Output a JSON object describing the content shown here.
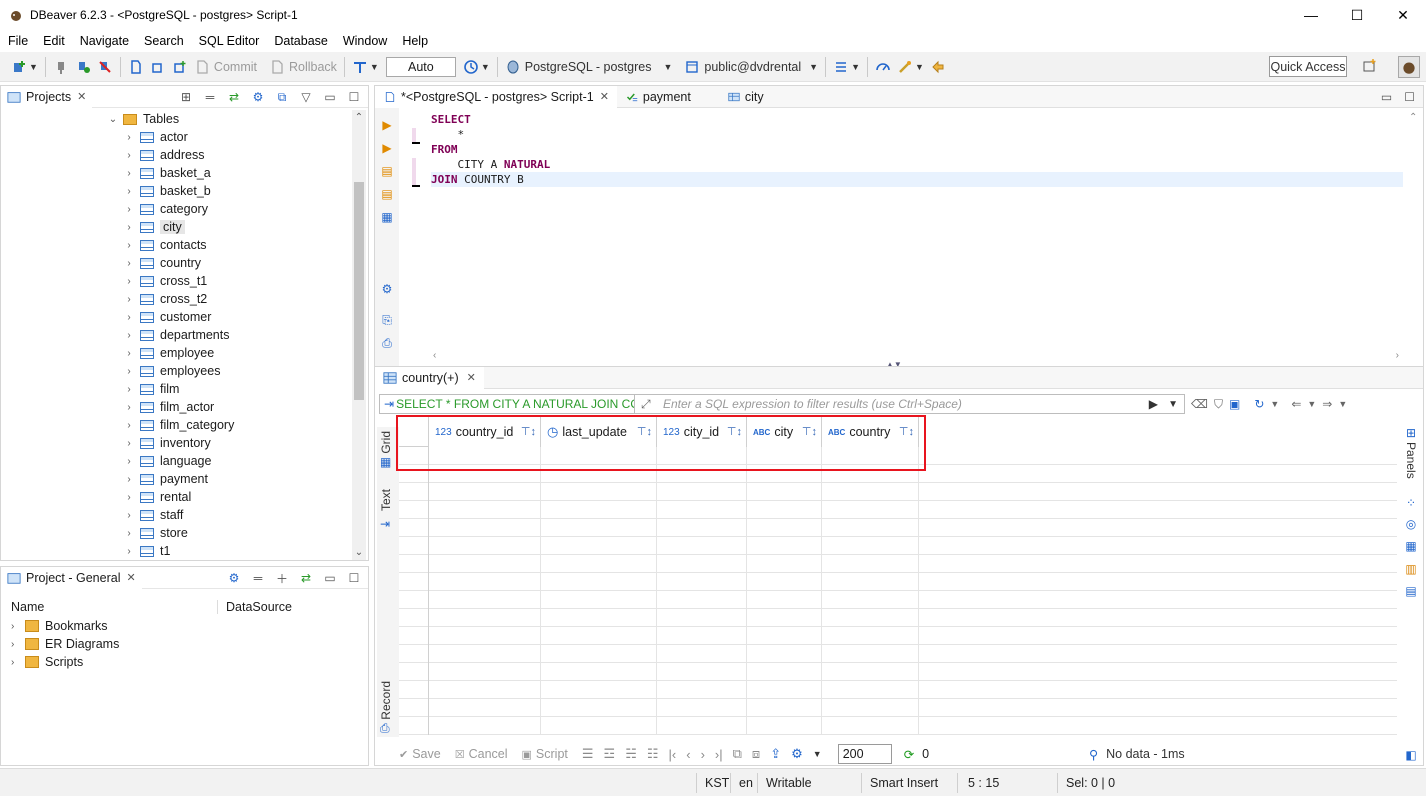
{
  "window": {
    "title": "DBeaver 6.2.3 - <PostgreSQL - postgres> Script-1",
    "minimize": "—",
    "maximize": "☐",
    "close": "✕"
  },
  "menu": [
    "File",
    "Edit",
    "Navigate",
    "Search",
    "SQL Editor",
    "Database",
    "Window",
    "Help"
  ],
  "toolbar": {
    "commit": "Commit",
    "rollback": "Rollback",
    "tx_mode": "Auto",
    "datasource": "PostgreSQL - postgres",
    "schema": "public@dvdrental",
    "quick_access": "Quick Access"
  },
  "projects_panel": {
    "tab": "Projects",
    "folder": "Tables",
    "tables": [
      "actor",
      "address",
      "basket_a",
      "basket_b",
      "category",
      "city",
      "contacts",
      "country",
      "cross_t1",
      "cross_t2",
      "customer",
      "departments",
      "employee",
      "employees",
      "film",
      "film_actor",
      "film_category",
      "inventory",
      "language",
      "payment",
      "rental",
      "staff",
      "store",
      "t1"
    ],
    "selected": "city"
  },
  "project_general": {
    "tab": "Project - General",
    "col_name": "Name",
    "col_datasource": "DataSource",
    "items": [
      "Bookmarks",
      "ER Diagrams",
      "Scripts"
    ]
  },
  "editor": {
    "tabs": [
      {
        "label": "*<PostgreSQL - postgres> Script-1",
        "active": true
      },
      {
        "label": "payment",
        "active": false
      },
      {
        "label": "city",
        "active": false
      }
    ],
    "lines": [
      [
        {
          "t": "SELECT",
          "k": true
        }
      ],
      [
        {
          "t": "    *",
          "k": false
        }
      ],
      [
        {
          "t": "FROM",
          "k": true
        }
      ],
      [
        {
          "t": "    CITY A ",
          "k": false
        },
        {
          "t": "NATURAL",
          "k": true
        }
      ],
      [
        {
          "t": "JOIN",
          "k": true
        },
        {
          "t": " COUNTRY B",
          "k": false
        }
      ]
    ]
  },
  "results": {
    "tab": "country(+)",
    "query": "SELECT * FROM CITY A NATURAL JOIN COUNTRY B",
    "filter_placeholder": "Enter a SQL expression to filter results (use Ctrl+Space)",
    "side_grid": "Grid",
    "side_text": "Text",
    "side_record": "Record",
    "side_panels": "Panels",
    "columns": [
      {
        "name": "country_id",
        "type": "123"
      },
      {
        "name": "last_update",
        "type": "clock"
      },
      {
        "name": "city_id",
        "type": "123"
      },
      {
        "name": "city",
        "type": "ABC"
      },
      {
        "name": "country",
        "type": "ABC"
      }
    ],
    "save": "Save",
    "cancel": "Cancel",
    "script": "Script",
    "fetch_size": "200",
    "row_count": "0",
    "status": "No data - 1ms"
  },
  "statusbar": {
    "timezone": "KST",
    "locale": "en",
    "mode": "Writable",
    "insert": "Smart Insert",
    "cursor": "5 : 15",
    "selection": "Sel: 0 | 0"
  },
  "colors": {
    "keyword": "#7f0055",
    "highlight": "#e8141e",
    "accent": "#2266cc"
  }
}
